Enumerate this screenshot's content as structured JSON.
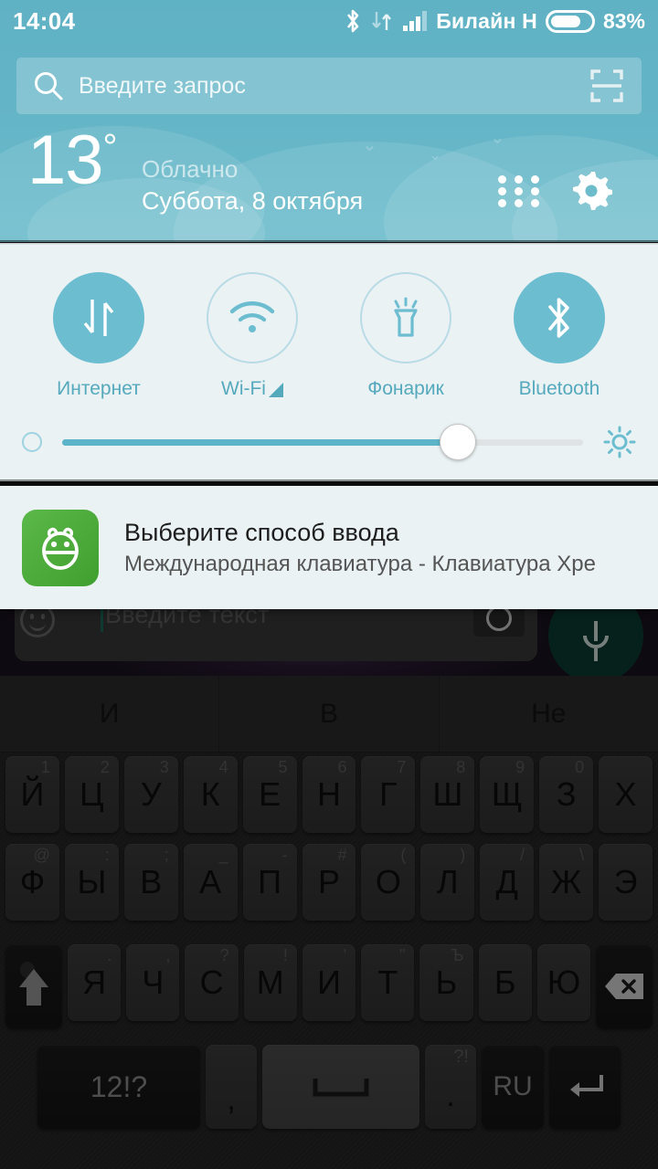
{
  "status_bar": {
    "clock": "14:04",
    "carrier": "Билайн H",
    "battery_percent": "83%",
    "icons": [
      "bluetooth-icon",
      "data-transfer-icon",
      "signal-bars-icon",
      "battery-icon"
    ]
  },
  "search": {
    "placeholder": "Введите запрос",
    "search_icon": "search-icon",
    "scan_icon": "scan-code-icon"
  },
  "weather": {
    "temperature": "13",
    "degree_symbol": "°",
    "condition": "Облачно",
    "date": "Суббота, 8 октября",
    "apps_icon": "apps-grid-icon",
    "settings_icon": "gear-icon"
  },
  "quick_settings": {
    "toggles": [
      {
        "label": "Интернет",
        "icon": "data-transfer-icon",
        "state": "on"
      },
      {
        "label": "Wi-Fi",
        "icon": "wifi-icon",
        "state": "off",
        "suffix_icon": "signal-triangle-icon"
      },
      {
        "label": "Фонарик",
        "icon": "flashlight-icon",
        "state": "off"
      },
      {
        "label": "Bluetooth",
        "icon": "bluetooth-icon",
        "state": "on"
      }
    ],
    "brightness": {
      "value_percent": 76,
      "low_icon": "brightness-low-icon",
      "high_icon": "brightness-high-icon"
    }
  },
  "notification": {
    "icon": "android-input-method-icon",
    "title": "Выберите способ ввода",
    "body": "Международная клавиатура - Клавиатура Xperi"
  },
  "background_app": {
    "composer_placeholder": "Введите текст",
    "emoji_icon": "emoji-icon",
    "camera_icon": "camera-icon",
    "mic_icon": "microphone-icon"
  },
  "keyboard": {
    "suggestions": [
      "И",
      "В",
      "Не"
    ],
    "rows": [
      [
        {
          "glyph": "Й",
          "hint": "1"
        },
        {
          "glyph": "Ц",
          "hint": "2"
        },
        {
          "glyph": "У",
          "hint": "3"
        },
        {
          "glyph": "К",
          "hint": "4"
        },
        {
          "glyph": "Е",
          "hint": "5"
        },
        {
          "glyph": "Н",
          "hint": "6"
        },
        {
          "glyph": "Г",
          "hint": "7"
        },
        {
          "glyph": "Ш",
          "hint": "8"
        },
        {
          "glyph": "Щ",
          "hint": "9"
        },
        {
          "glyph": "З",
          "hint": "0"
        },
        {
          "glyph": "Х",
          "hint": ""
        }
      ],
      [
        {
          "glyph": "Ф",
          "hint": "@"
        },
        {
          "glyph": "Ы",
          "hint": ":"
        },
        {
          "glyph": "В",
          "hint": ";"
        },
        {
          "glyph": "А",
          "hint": "_"
        },
        {
          "glyph": "П",
          "hint": "-"
        },
        {
          "glyph": "Р",
          "hint": "#"
        },
        {
          "glyph": "О",
          "hint": "("
        },
        {
          "glyph": "Л",
          "hint": ")"
        },
        {
          "glyph": "Д",
          "hint": "/"
        },
        {
          "glyph": "Ж",
          "hint": "\\"
        },
        {
          "glyph": "Э",
          "hint": ""
        }
      ],
      [
        {
          "glyph": "Я",
          "hint": "."
        },
        {
          "glyph": "Ч",
          "hint": ","
        },
        {
          "glyph": "С",
          "hint": "?"
        },
        {
          "glyph": "М",
          "hint": "!"
        },
        {
          "glyph": "И",
          "hint": "'"
        },
        {
          "glyph": "Т",
          "hint": "\""
        },
        {
          "glyph": "Ь",
          "hint": "Ъ"
        },
        {
          "glyph": "Б",
          "hint": ""
        },
        {
          "glyph": "Ю",
          "hint": ""
        }
      ]
    ],
    "shift_key": "shift-icon",
    "backspace_key": "backspace-icon",
    "symbols_key": "12!?",
    "comma_key": ",",
    "space_key": "space-icon",
    "period_key": ".",
    "period_hint": "?!",
    "language_key": "RU",
    "enter_key": "enter-icon"
  }
}
